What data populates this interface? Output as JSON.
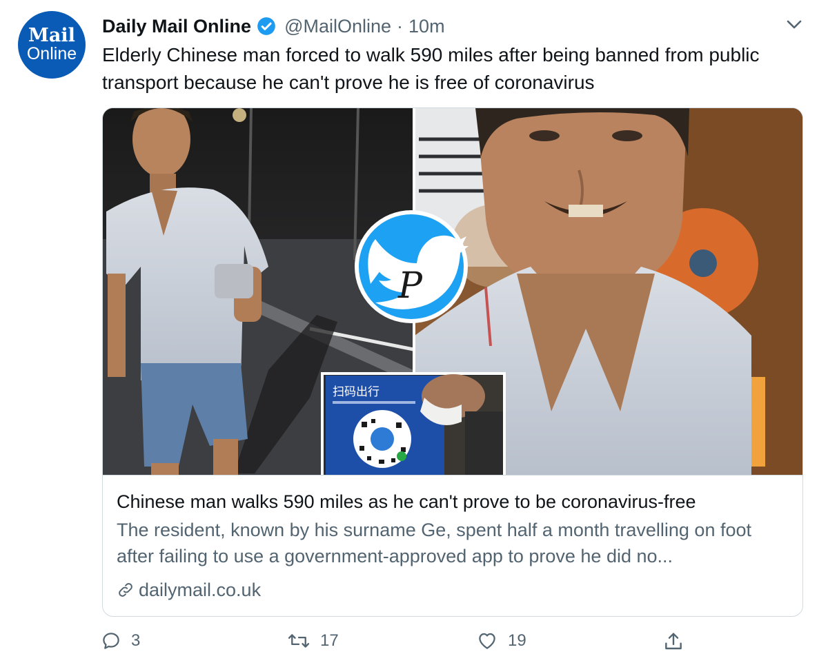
{
  "author": {
    "avatar_line1": "Mail",
    "avatar_line2": "Online",
    "name": "Daily Mail Online",
    "handle": "@MailOnline",
    "separator": "·",
    "time": "10m"
  },
  "tweet": {
    "text": "Elderly Chinese man forced to walk 590 miles after being banned from public transport because he can't prove he is free of coronavirus"
  },
  "media": {
    "sign_text": "扫码出行",
    "watermark_letter": "P"
  },
  "card": {
    "title": "Chinese man walks 590 miles as he can't prove to be coronavirus-free",
    "description": "The resident, known by his surname Ge, spent half a month travelling on foot after failing to use a government-approved app to prove he did no...",
    "domain": "dailymail.co.uk"
  },
  "actions": {
    "replies": "3",
    "retweets": "17",
    "likes": "19"
  },
  "colors": {
    "brand_blue": "#0a5bb5",
    "verified_blue": "#1d9bf0",
    "watermark_blue": "#1da1f2",
    "secondary_text": "#536471"
  }
}
